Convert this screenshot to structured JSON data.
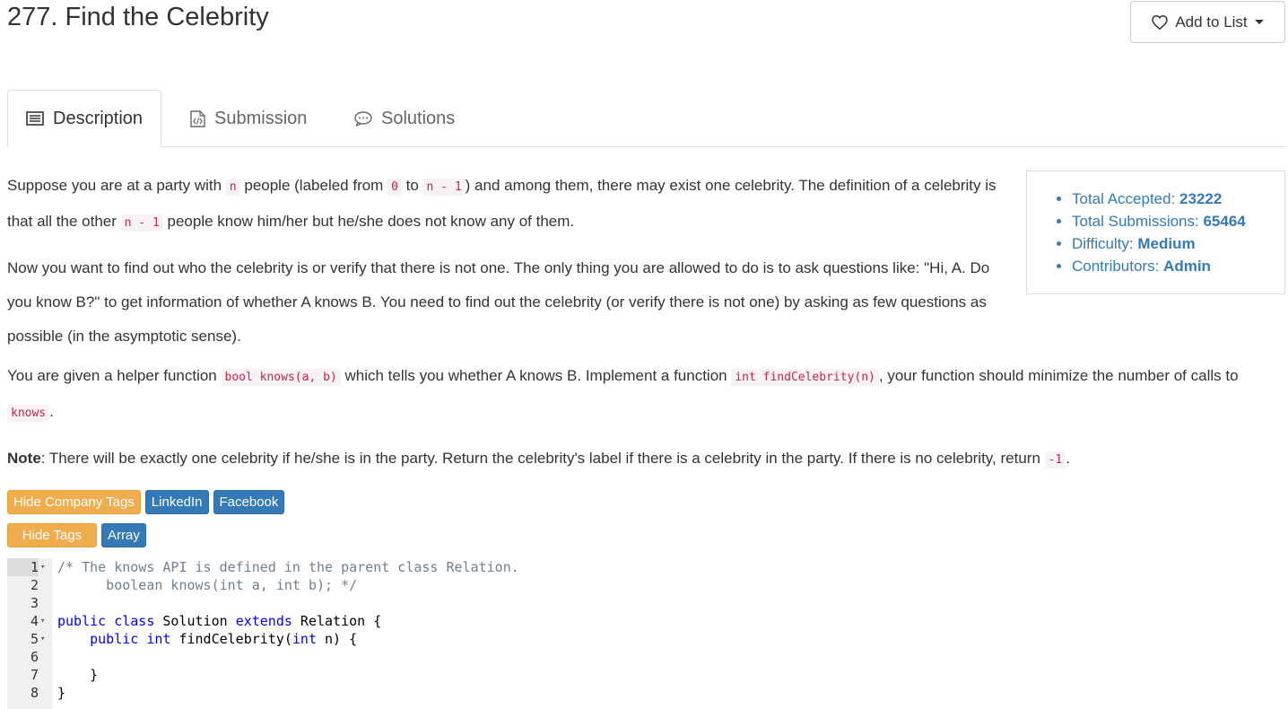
{
  "problem": {
    "title": "277. Find the Celebrity"
  },
  "header": {
    "add_to_list_label": "Add to List"
  },
  "tabs": [
    {
      "label": "Description",
      "icon": "list-icon",
      "active": true
    },
    {
      "label": "Submission",
      "icon": "code-file-icon",
      "active": false
    },
    {
      "label": "Solutions",
      "icon": "chat-bubble-icon",
      "active": false
    }
  ],
  "description": {
    "p1": {
      "t1": "Suppose you are at a party with ",
      "c1": "n",
      "t2": " people (labeled from ",
      "c2": "0",
      "t3": " to ",
      "c3": "n - 1",
      "t4": ") and among them, there may exist one celebrity. The definition of a celebrity is that all the other ",
      "c4": "n - 1",
      "t5": " people know him/her but he/she does not know any of them."
    },
    "p2": "Now you want to find out who the celebrity is or verify that there is not one. The only thing you are allowed to do is to ask questions like: \"Hi, A. Do you know B?\" to get information of whether A knows B. You need to find out the celebrity (or verify there is not one) by asking as few questions as possible (in the asymptotic sense).",
    "p3": {
      "t1": "You are given a helper function ",
      "c1": "bool knows(a, b)",
      "t2": " which tells you whether A knows B. Implement a function ",
      "c2": "int findCelebrity(n)",
      "t3": ", your function should minimize the number of calls to ",
      "c3": "knows",
      "t4": "."
    },
    "p4": {
      "label": "Note",
      "t1": ": There will be exactly one celebrity if he/she is in the party. Return the celebrity's label if there is a celebrity in the party. If there is no celebrity, return ",
      "c1": "-1",
      "t2": "."
    }
  },
  "stats": {
    "accepted_label": "Total Accepted: ",
    "accepted_value": "23222",
    "submissions_label": "Total Submissions: ",
    "submissions_value": "65464",
    "difficulty_label": "Difficulty: ",
    "difficulty_value": "Medium",
    "contributors_label": "Contributors: ",
    "contributors_value": "Admin"
  },
  "company_tags": {
    "toggle_label": "Hide Company Tags",
    "tags": [
      "LinkedIn",
      "Facebook"
    ]
  },
  "topic_tags": {
    "toggle_label": "Hide Tags",
    "tags": [
      "Array"
    ]
  },
  "editor": {
    "lines": [
      {
        "num": "1",
        "fold": true,
        "parts": [
          {
            "cls": "cmt",
            "t": "/* The knows API is defined in the parent class Relation."
          }
        ]
      },
      {
        "num": "2",
        "fold": false,
        "parts": [
          {
            "cls": "cmt",
            "t": "      boolean knows(int a, int b); */"
          }
        ]
      },
      {
        "num": "3",
        "fold": false,
        "parts": []
      },
      {
        "num": "4",
        "fold": true,
        "parts": [
          {
            "cls": "kw",
            "t": "public"
          },
          {
            "cls": "",
            "t": " "
          },
          {
            "cls": "kw",
            "t": "class"
          },
          {
            "cls": "",
            "t": " Solution "
          },
          {
            "cls": "kw",
            "t": "extends"
          },
          {
            "cls": "",
            "t": " Relation {"
          }
        ]
      },
      {
        "num": "5",
        "fold": true,
        "parts": [
          {
            "cls": "",
            "t": "    "
          },
          {
            "cls": "kw",
            "t": "public"
          },
          {
            "cls": "",
            "t": " "
          },
          {
            "cls": "kw",
            "t": "int"
          },
          {
            "cls": "",
            "t": " findCelebrity("
          },
          {
            "cls": "kw",
            "t": "int"
          },
          {
            "cls": "",
            "t": " n) {"
          }
        ]
      },
      {
        "num": "6",
        "fold": false,
        "parts": []
      },
      {
        "num": "7",
        "fold": false,
        "parts": [
          {
            "cls": "",
            "t": "    }"
          }
        ]
      },
      {
        "num": "8",
        "fold": false,
        "parts": [
          {
            "cls": "",
            "t": "}"
          }
        ]
      }
    ]
  }
}
